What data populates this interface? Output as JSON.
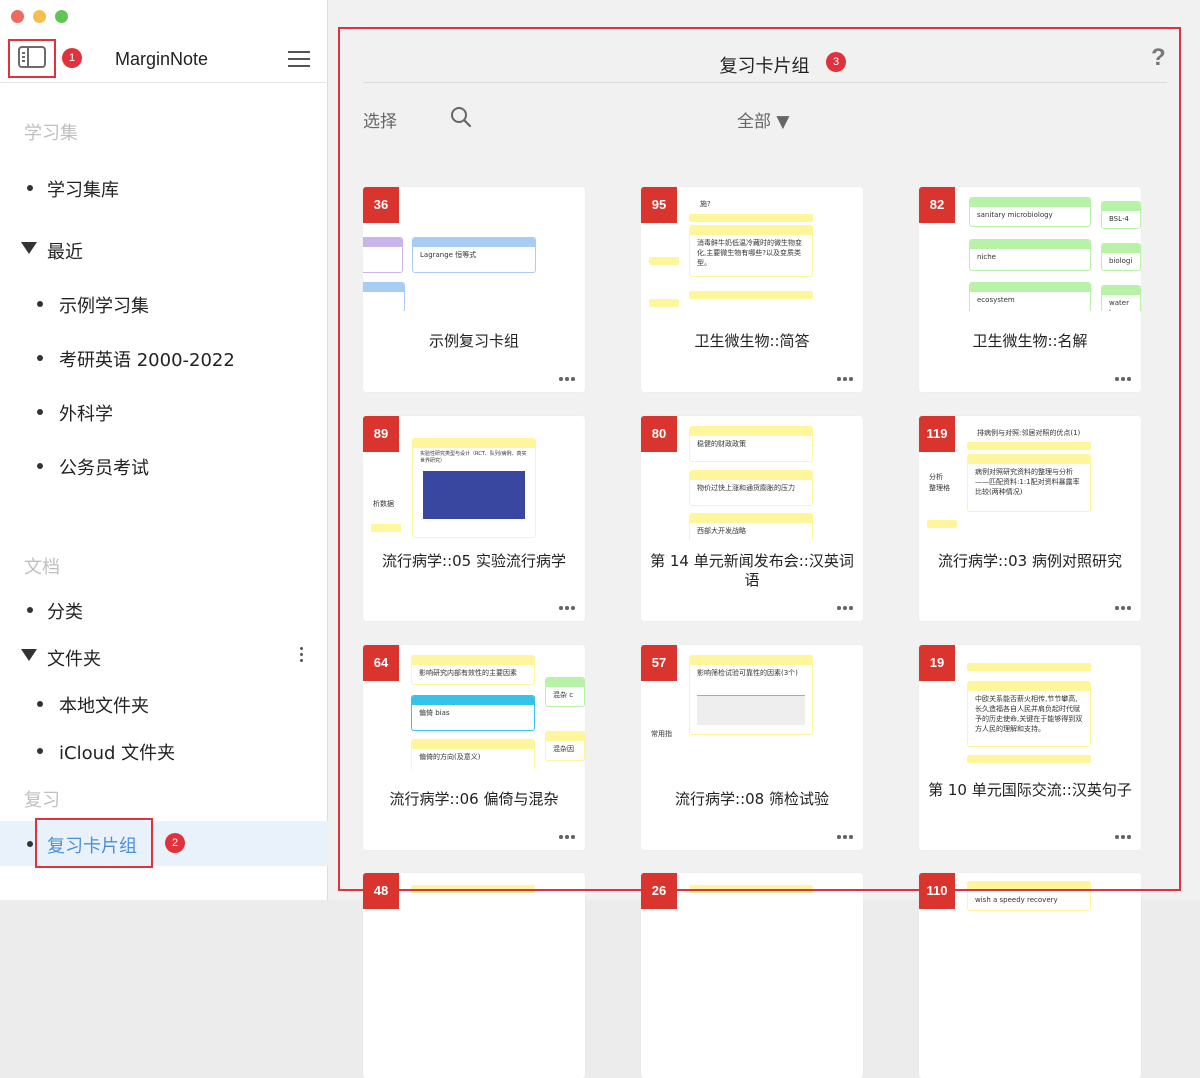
{
  "app": {
    "title": "MarginNote"
  },
  "annotations": {
    "sidebar_toggle": "1",
    "review_item": "2",
    "main_panel": "3"
  },
  "sidebar": {
    "section_study": "学习集",
    "study_library": "学习集库",
    "recent_label": "最近",
    "recent_items": [
      "示例学习集",
      "考研英语 2000-2022",
      "外科学",
      "公务员考试"
    ],
    "section_docs": "文档",
    "categories": "分类",
    "folders_label": "文件夹",
    "folder_items": [
      "本地文件夹",
      "iCloud 文件夹"
    ],
    "section_review": "复习",
    "review_decks": "复习卡片组"
  },
  "main": {
    "title": "复习卡片组",
    "help": "?",
    "select_label": "选择",
    "filter_label": "全部 ▼",
    "cards": [
      {
        "count": "36",
        "name": "示例复习卡组",
        "notes": [
          "Lagrange 恒等式"
        ]
      },
      {
        "count": "95",
        "name": "卫生微生物::简答",
        "notes": [
          "施?",
          "消毒鲜牛奶低温冷藏时的微生物变化,主要微生物有哪些?以及变质类型。"
        ]
      },
      {
        "count": "82",
        "name": "卫生微生物::名解",
        "notes": [
          "sanitary microbiology",
          "niche",
          "ecosystem",
          "BSL-4",
          "biologi",
          "water b"
        ]
      },
      {
        "count": "89",
        "name": "流行病学::05 实验流行病学",
        "notes": [
          "实验性研究类型与设计（RCT、队列/病例、真实世界研究）",
          "析数据"
        ]
      },
      {
        "count": "80",
        "name": "第 14 单元新闻发布会::汉英词语",
        "notes": [
          "稳健的财政政策",
          "物价过快上涨和通货膨胀的压力",
          "西部大开发战略"
        ]
      },
      {
        "count": "119",
        "name": "流行病学::03 病例对照研究",
        "notes": [
          "排病例与对照:邻居对照的优点(1)",
          "病例对照研究资料的整理与分析——匹配资料:1:1配对资料暴露率比较(两种情况)",
          "分析",
          "整理格"
        ]
      },
      {
        "count": "64",
        "name": "流行病学::06 偏倚与混杂",
        "notes": [
          "影响研究内部有效性的主要因素",
          "偏倚 bias",
          "偏倚的方向(及意义)",
          "混杂 c",
          "混杂因"
        ]
      },
      {
        "count": "57",
        "name": "流行病学::08 筛检试验",
        "notes": [
          "影响筛检试验可靠性的因素(3个)",
          "常用指"
        ]
      },
      {
        "count": "19",
        "name": "第 10 单元国际交流::汉英句子",
        "notes": [
          "中欧关系能否薪火相传,节节攀高,长久造福各自人民并肩负起时代赋予的历史使命,关键在于能够得到双方人民的理解和支持。"
        ]
      },
      {
        "count": "48",
        "name": "",
        "notes": []
      },
      {
        "count": "26",
        "name": "",
        "notes": []
      },
      {
        "count": "110",
        "name": "",
        "notes": [
          "wish a speedy recovery"
        ]
      }
    ]
  }
}
